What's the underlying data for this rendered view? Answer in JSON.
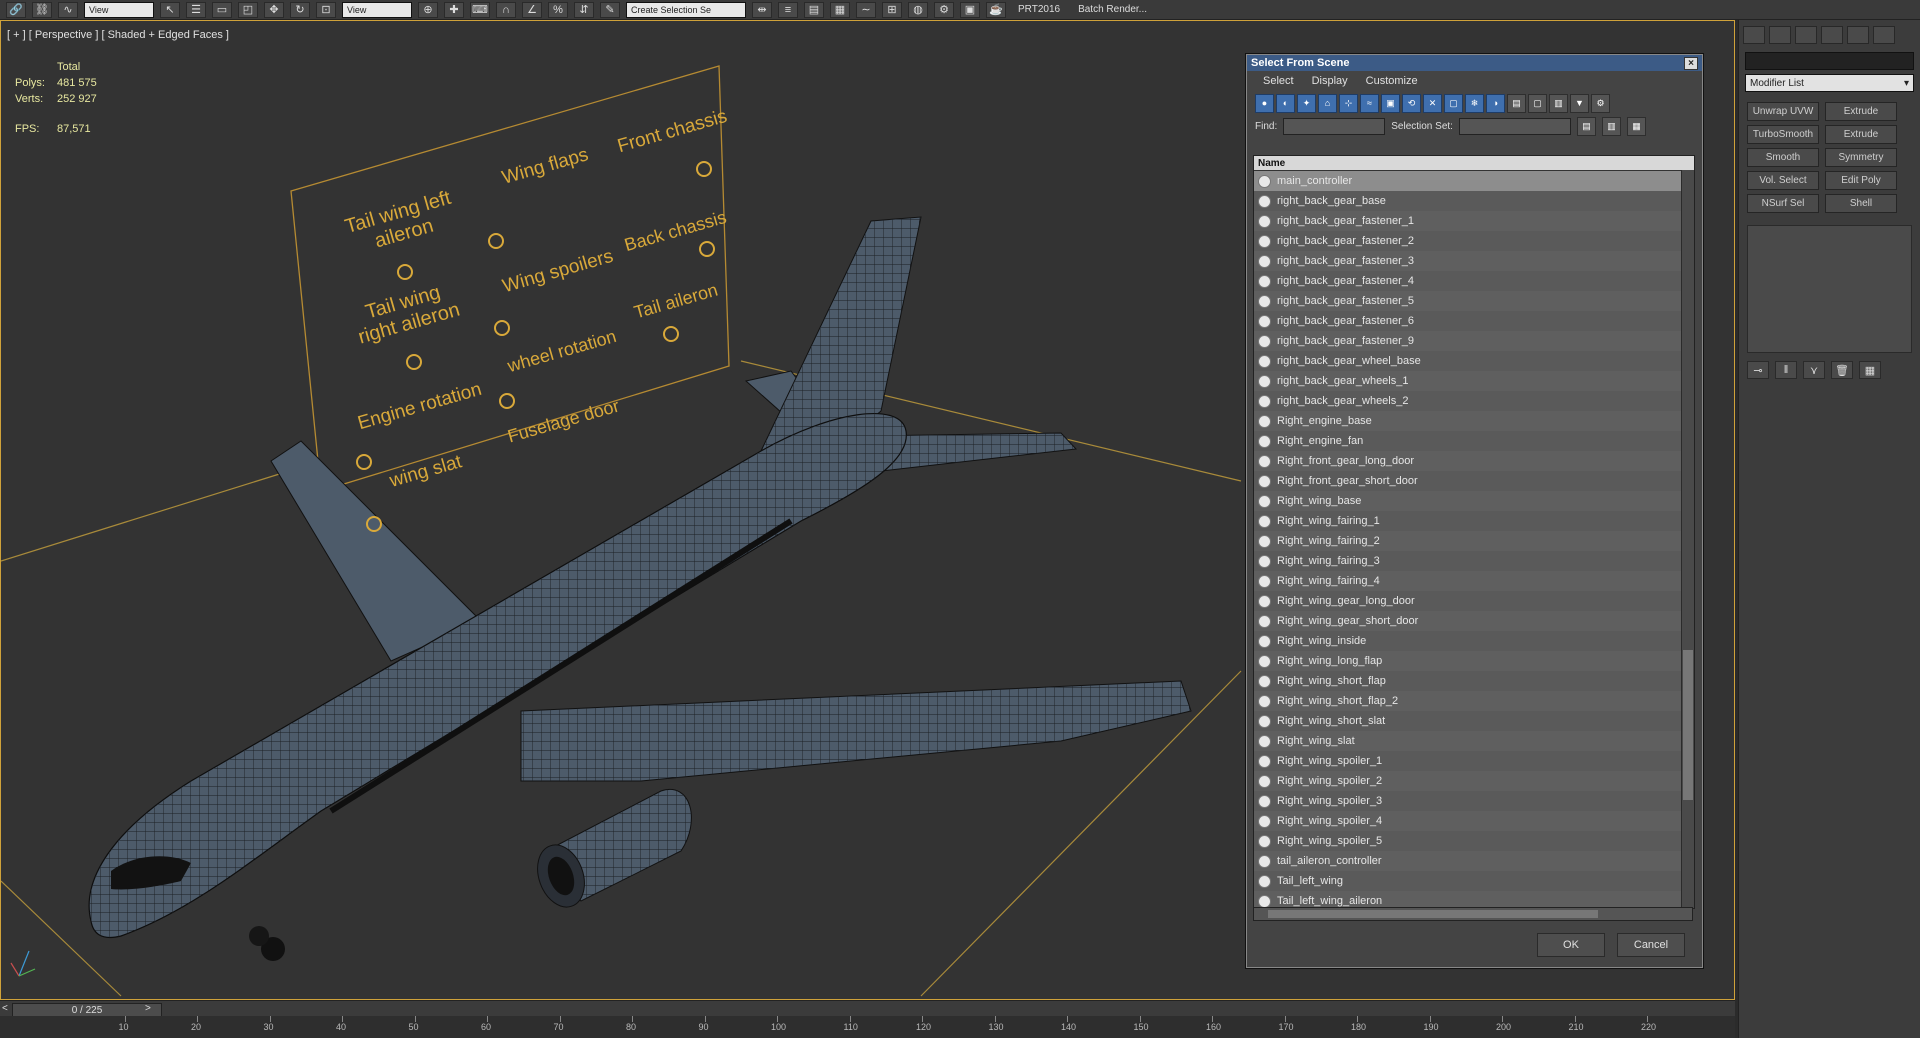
{
  "toolbar": {
    "view_dropdown": "View",
    "selection_dropdown": "Create Selection Se",
    "tab1": "PRT2016",
    "tab2": "Batch Render..."
  },
  "viewport": {
    "label": "[ + ] [ Perspective ] [ Shaded + Edged Faces ]",
    "stats_total": "Total",
    "polys_label": "Polys:",
    "polys_value": "481 575",
    "verts_label": "Verts:",
    "verts_value": "252 927",
    "fps_label": "FPS:",
    "fps_value": "87,571"
  },
  "control_panel_labels": [
    "Tail wing left aileron",
    "Wing flaps",
    "Front chassis",
    "Tail wing right aileron",
    "Wing spoilers",
    "Back chassis",
    "Engine rotation",
    "wheel rotation",
    "Tail aileron",
    "wing slat",
    "Fuselage door"
  ],
  "dialog": {
    "title": "Select From Scene",
    "menu": [
      "Select",
      "Display",
      "Customize"
    ],
    "find_label": "Find:",
    "selection_set_label": "Selection Set:",
    "column_name": "Name",
    "items": [
      "main_controller",
      "right_back_gear_base",
      "right_back_gear_fastener_1",
      "right_back_gear_fastener_2",
      "right_back_gear_fastener_3",
      "right_back_gear_fastener_4",
      "right_back_gear_fastener_5",
      "right_back_gear_fastener_6",
      "right_back_gear_fastener_9",
      "right_back_gear_wheel_base",
      "right_back_gear_wheels_1",
      "right_back_gear_wheels_2",
      "Right_engine_base",
      "Right_engine_fan",
      "Right_front_gear_long_door",
      "Right_front_gear_short_door",
      "Right_wing_base",
      "Right_wing_fairing_1",
      "Right_wing_fairing_2",
      "Right_wing_fairing_3",
      "Right_wing_fairing_4",
      "Right_wing_gear_long_door",
      "Right_wing_gear_short_door",
      "Right_wing_inside",
      "Right_wing_long_flap",
      "Right_wing_short_flap",
      "Right_wing_short_flap_2",
      "Right_wing_short_slat",
      "Right_wing_slat",
      "Right_wing_spoiler_1",
      "Right_wing_spoiler_2",
      "Right_wing_spoiler_3",
      "Right_wing_spoiler_4",
      "Right_wing_spoiler_5",
      "tail_aileron_controller",
      "Tail_left_wing",
      "Tail_left_wing_aileron"
    ],
    "ok_label": "OK",
    "cancel_label": "Cancel"
  },
  "right_panel": {
    "modifier_list": "Modifier List",
    "modifiers": [
      "Unwrap UVW",
      "Extrude",
      "TurboSmooth",
      "Extrude",
      "Smooth",
      "Symmetry",
      "Vol. Select",
      "Edit Poly",
      "NSurf Sel",
      "Shell"
    ]
  },
  "timeline": {
    "frame": "0 / 225",
    "ticks": [
      "10",
      "20",
      "30",
      "40",
      "50",
      "60",
      "70",
      "80",
      "90",
      "100",
      "110",
      "120",
      "130",
      "140",
      "150",
      "160",
      "170",
      "180",
      "190",
      "200",
      "210",
      "220"
    ]
  },
  "colors": {
    "viewport_bg": "#333333",
    "panel_text": "#d9a93a",
    "dialog_title": "#3c5b86",
    "mesh": "#4d5b6a"
  }
}
